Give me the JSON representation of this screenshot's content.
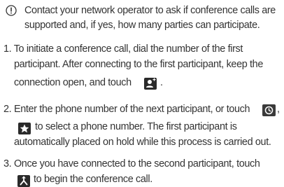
{
  "note": {
    "icon": "info-exclamation-icon",
    "line1": "Contact your network operator to ask if conference calls are",
    "line2": "supported and, if yes, how many parties can participate."
  },
  "steps": [
    {
      "lines": [
        "1. To initiate a conference call, dial the number of the first",
        "participant. After connecting to the first participant, keep the",
        "connection open, and touch"
      ],
      "after_icon": ".",
      "icon": "add-call-icon"
    },
    {
      "lines": [
        "2. Enter the phone number of the next participant, or touch",
        "to select a phone number. The first participant is",
        "automatically placed on hold while this process is carried out."
      ],
      "after_icon_1": ",",
      "icon_1": "call-log-icon",
      "icon_2": "favorites-star-icon"
    },
    {
      "lines": [
        "3. Once you have connected to the second participant, touch",
        "to begin the conference call."
      ],
      "icon": "merge-calls-icon"
    }
  ]
}
